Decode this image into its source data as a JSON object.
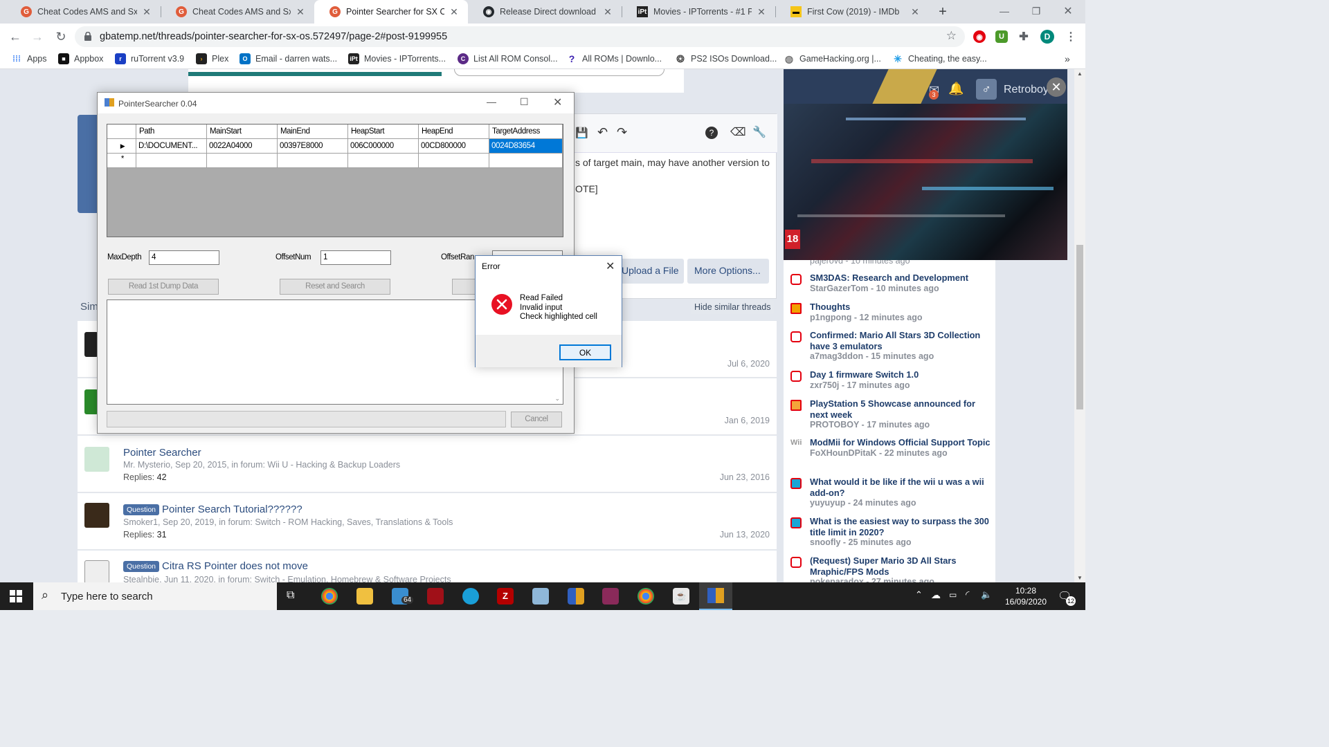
{
  "browser": {
    "tabs": [
      {
        "label": "Cheat Codes AMS and Sx Os",
        "active": false
      },
      {
        "label": "Cheat Codes AMS and Sx Os",
        "active": false
      },
      {
        "label": "Pointer Searcher for SX OS | I",
        "active": true
      },
      {
        "label": "Release Direct download poi",
        "active": false
      },
      {
        "label": "Movies - IPTorrents - #1 Priv",
        "active": false
      },
      {
        "label": "First Cow (2019) - IMDb",
        "active": false
      }
    ],
    "url": "gbatemp.net/threads/pointer-searcher-for-sx-os.572497/page-2#post-9199955",
    "profile_initial": "D",
    "bookmarks": [
      {
        "label": "Apps"
      },
      {
        "label": "Appbox"
      },
      {
        "label": "ruTorrent v3.9"
      },
      {
        "label": "Plex"
      },
      {
        "label": "Email - darren wats..."
      },
      {
        "label": "Movies - IPTorrents..."
      },
      {
        "label": "List All ROM Consol..."
      },
      {
        "label": "All ROMs | Downlo..."
      },
      {
        "label": "PS2 ISOs Download..."
      },
      {
        "label": "GameHacking.org |..."
      },
      {
        "label": "Cheating, the easy..."
      }
    ],
    "bookmarks_more": "»"
  },
  "page": {
    "post_text_line1": "s of target main, may have another version to",
    "post_text_line2": "OTE]",
    "upload_button": "Upload a File",
    "more_options_button": "More Options...",
    "similar_heading": "Sim",
    "hide_similar": "Hide similar threads",
    "threads": [
      {
        "prefix": "",
        "title": "",
        "meta": "",
        "replies_label": "",
        "replies": "",
        "date": "Jul 6, 2020"
      },
      {
        "prefix": "",
        "title": "",
        "meta": "",
        "replies_label": "",
        "replies": "",
        "date": "Jan 6, 2019"
      },
      {
        "prefix": "",
        "title": "Pointer Searcher",
        "meta": "Mr. Mysterio, Sep 20, 2015, in forum: Wii U - Hacking & Backup Loaders",
        "replies_label": "Replies:",
        "replies": "42",
        "date": "Jun 23, 2016"
      },
      {
        "prefix": "Question",
        "title": "Pointer Search Tutorial??????",
        "meta": "Smoker1, Sep 20, 2019, in forum: Switch - ROM Hacking, Saves, Translations & Tools",
        "replies_label": "Replies:",
        "replies": "31",
        "date": "Jun 13, 2020"
      },
      {
        "prefix": "Question",
        "title": "Citra RS Pointer does not move",
        "meta": "Stealnbie, Jun 11, 2020, in forum: Switch - Emulation, Homebrew & Software Projects",
        "replies_label": "",
        "replies": "",
        "date": ""
      }
    ],
    "sidebar_top_meta": "pajerovd - 10 minutes ago",
    "sidebar": [
      {
        "title": "SM3DAS: Research and Development",
        "meta": "StarGazerTom - 10 minutes ago",
        "icon": "switch"
      },
      {
        "title": "Thoughts",
        "meta": "p1ngpong - 12 minutes ago",
        "icon": "notes"
      },
      {
        "title": "Confirmed: Mario All Stars 3D Collection have 3 emulators",
        "meta": "a7mag3ddon - 15 minutes ago",
        "icon": "switch"
      },
      {
        "title": "Day 1 firmware Switch 1.0",
        "meta": "zxr750j - 17 minutes ago",
        "icon": "switch"
      },
      {
        "title": "PlayStation 5 Showcase announced for next week",
        "meta": "PROTOBOY - 17 minutes ago",
        "icon": "news"
      },
      {
        "title": "ModMii for Windows Official Support Topic",
        "meta": "FoXHounDPitaK - 22 minutes ago",
        "icon": "wii"
      },
      {
        "title": "What would it be like if the wii u was a wii add-on?",
        "meta": "yuyuyup - 24 minutes ago",
        "icon": "wiiu"
      },
      {
        "title": "What is the easiest way to surpass the 300 title limit in 2020?",
        "meta": "snoofly - 25 minutes ago",
        "icon": "wiiu"
      },
      {
        "title": "(Request) Super Mario 3D All Stars Mraphic/FPS Mods",
        "meta": "pokeparadox - 27 minutes ago",
        "icon": "switch"
      }
    ],
    "wii_label": "Wii",
    "video": {
      "username": "Retroboy",
      "notif_count": "3",
      "rating": "18"
    }
  },
  "pointer_searcher": {
    "title": "PointerSearcher 0.04",
    "columns": [
      "Path",
      "MainStart",
      "MainEnd",
      "HeapStart",
      "HeapEnd",
      "TargetAddress"
    ],
    "row": [
      "D:\\DOCUMENT...",
      "0022A04000",
      "00397E8000",
      "006C000000",
      "00CD800000",
      "0024D83654"
    ],
    "row_marker": "▶",
    "new_row_marker": "*",
    "max_depth_label": "MaxDepth",
    "max_depth_value": "4",
    "offset_num_label": "OffsetNum",
    "offset_num_value": "1",
    "offset_range_label": "OffsetRan",
    "read_button": "Read 1st Dump Data",
    "reset_button": "Reset and Search",
    "cancel_button": "Cancel"
  },
  "error_dialog": {
    "title": "Error",
    "line1": "Read Failed",
    "line2": "Invalid input",
    "line3": "Check highlighted cell",
    "ok_button": "OK"
  },
  "taskbar": {
    "search_placeholder": "Type here to search",
    "mail_badge": "64",
    "time": "10:28",
    "date": "16/09/2020",
    "notification_count": "12"
  },
  "colors": {
    "accent": "#0078d7",
    "forum_link": "#2b4c7e",
    "error_red": "#e81123"
  }
}
